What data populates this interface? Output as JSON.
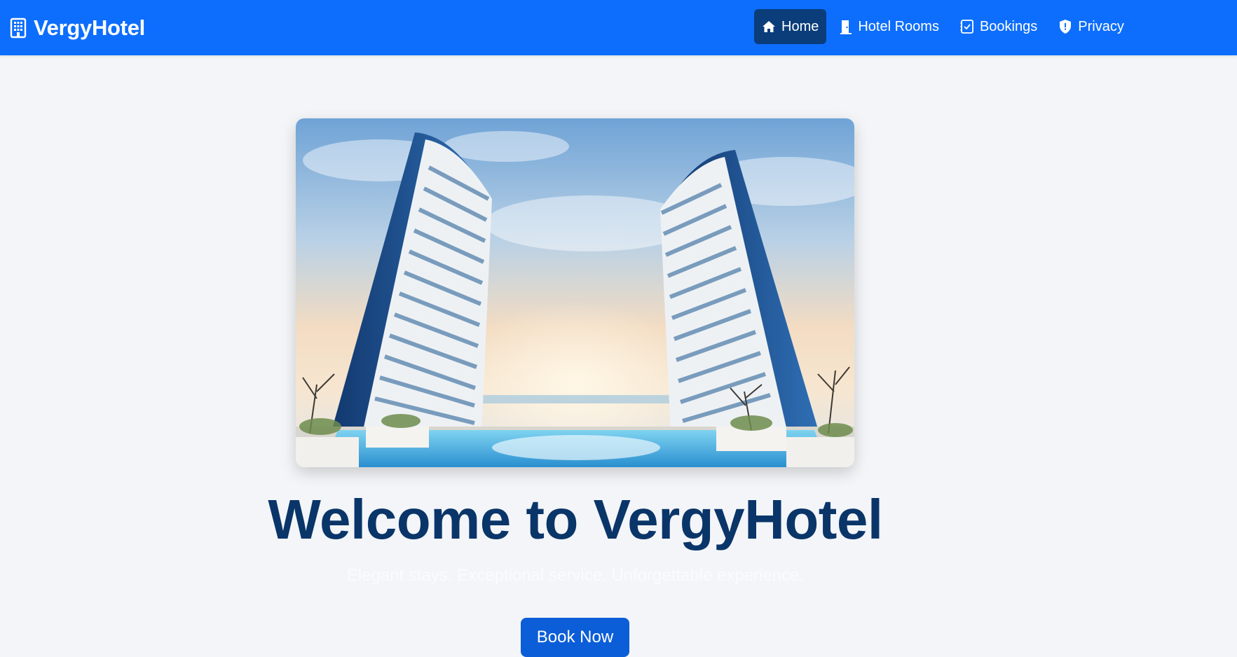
{
  "brand": {
    "name": "VergyHotel",
    "icon": "building-icon"
  },
  "nav": {
    "items": [
      {
        "label": "Home",
        "icon": "house-icon",
        "active": true
      },
      {
        "label": "Hotel Rooms",
        "icon": "door-icon",
        "active": false
      },
      {
        "label": "Bookings",
        "icon": "checklist-icon",
        "active": false
      },
      {
        "label": "Privacy",
        "icon": "shield-icon",
        "active": false
      }
    ]
  },
  "hero": {
    "image_alt": "hotel-towers-image",
    "title": "Welcome to VergyHotel",
    "subtitle": "Elegant stays. Exceptional service. Unforgettable experience.",
    "cta_label": "Book Now"
  },
  "colors": {
    "navbar": "#0d6efd",
    "active_nav": "#0a3d7a",
    "title": "#0a3569",
    "button": "#0b5ed7",
    "page_bg": "#f3f5f8"
  }
}
